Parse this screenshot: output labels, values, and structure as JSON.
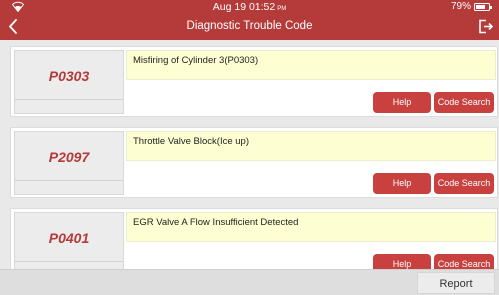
{
  "status": {
    "date": "Aug 19",
    "time": "01:52",
    "ampm": "PM",
    "battery_text": "79%",
    "battery_level": 0.79,
    "wifi_icon": "wifi-icon"
  },
  "header": {
    "title": "Diagnostic Trouble Code",
    "back_icon": "back-arrow-icon",
    "exit_icon": "exit-icon"
  },
  "codes": [
    {
      "code": "P0303",
      "description": "Misfiring of Cylinder 3(P0303)",
      "help_label": "Help",
      "search_label": "Code Search"
    },
    {
      "code": "P2097",
      "description": "Throttle Valve Block(Ice up)",
      "help_label": "Help",
      "search_label": "Code Search"
    },
    {
      "code": "P0401",
      "description": "EGR Valve A Flow Insufficient Detected",
      "help_label": "Help",
      "search_label": "Code Search"
    }
  ],
  "footer": {
    "report_label": "Report"
  },
  "colors": {
    "accent": "#b53a3a",
    "button": "#c8413f",
    "description_bg": "#fefed3",
    "page_bg": "#e9e9e9"
  }
}
